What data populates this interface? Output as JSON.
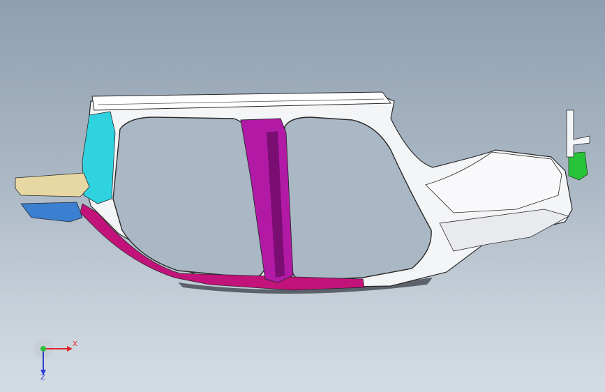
{
  "viewport": {
    "background_top": "#8f9fb1",
    "background_bottom": "#d4dce3"
  },
  "model": {
    "colors": {
      "main_frame": "#f4f5f7",
      "outline": "#2a2a2a",
      "b_pillar": "#b21aa6",
      "b_pillar_dark": "#7a0e72",
      "sill": "#c2137a",
      "a_pillar_inner": "#2fd3e0",
      "hinge_part": "#e7d7a3",
      "bracket_blue": "#3a7fd0",
      "latch_green": "#27c43a",
      "under_shadow": "#4a4f58"
    }
  },
  "triad": {
    "x_label": "X",
    "z_label": "Z",
    "x_color": "#e0262b",
    "y_color": "#2fbf3a",
    "z_color": "#2b3fcf"
  }
}
